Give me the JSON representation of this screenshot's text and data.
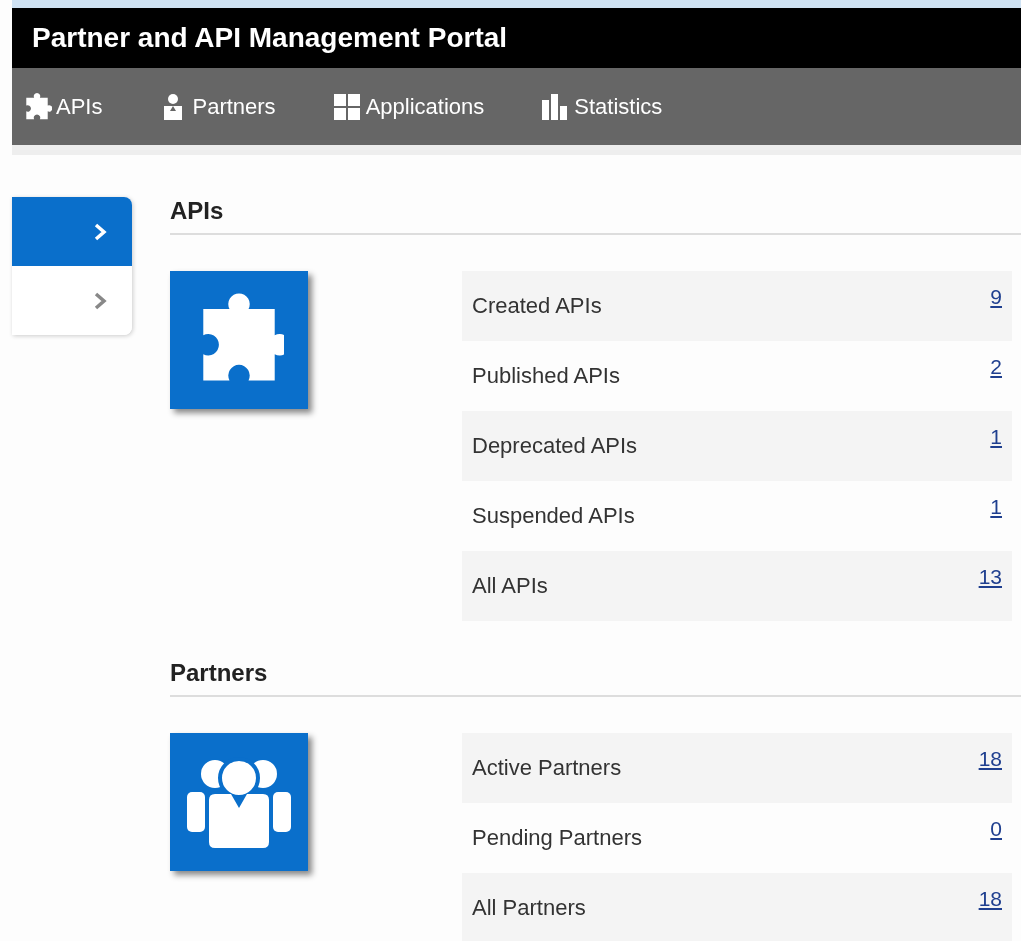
{
  "header": {
    "title": "Partner and API Management Portal"
  },
  "nav": [
    {
      "label": "APIs",
      "kind": "puzzle"
    },
    {
      "label": "Partners",
      "kind": "person"
    },
    {
      "label": "Applications",
      "kind": "grid"
    },
    {
      "label": "Statistics",
      "kind": "bars"
    }
  ],
  "sidebar": {
    "items": [
      {
        "selected": true
      },
      {
        "selected": false
      }
    ]
  },
  "sections": [
    {
      "title": "APIs",
      "kind": "puzzle",
      "rows": [
        {
          "label": "Created APIs",
          "count": "9"
        },
        {
          "label": "Published APIs",
          "count": "2"
        },
        {
          "label": "Deprecated APIs",
          "count": "1"
        },
        {
          "label": "Suspended APIs",
          "count": "1"
        },
        {
          "label": "All APIs",
          "count": "13"
        }
      ]
    },
    {
      "title": "Partners",
      "kind": "group",
      "rows": [
        {
          "label": "Active Partners",
          "count": "18"
        },
        {
          "label": "Pending Partners",
          "count": "0"
        },
        {
          "label": "All Partners",
          "count": "18"
        }
      ]
    }
  ]
}
